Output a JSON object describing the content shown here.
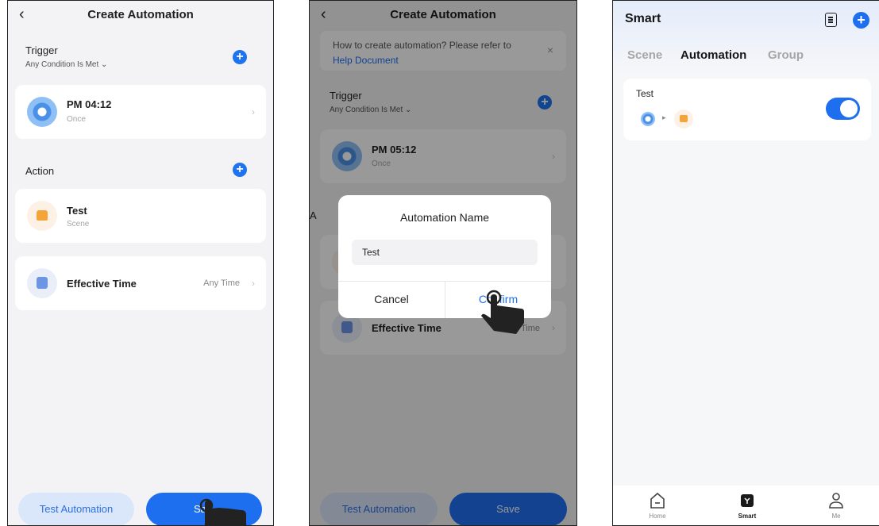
{
  "screen1": {
    "header_title": "Create Automation",
    "back_glyph": "‹",
    "trigger_title": "Trigger",
    "trigger_condition": "Any Condition Is Met",
    "trigger_card": {
      "title": "PM 04:12",
      "subtitle": "Once",
      "icon": "clock-icon"
    },
    "action_title": "Action",
    "action_card": {
      "title": "Test",
      "subtitle": "Scene",
      "icon": "scene-house-icon"
    },
    "effective_card": {
      "title": "Effective Time",
      "value": "Any Time",
      "icon": "calendar-icon"
    },
    "test_button": "Test Automation",
    "save_button": "Sa"
  },
  "screen2": {
    "header_title": "Create Automation",
    "tip_text": "How to create automation? Please refer to",
    "tip_link": "Help Document",
    "trigger_title": "Trigger",
    "trigger_condition": "Any Condition Is Met",
    "trigger_card": {
      "title": "PM 05:12",
      "subtitle": "Once"
    },
    "action_title_partial": "A",
    "effective_card": {
      "title": "Effective Time",
      "value_partial": "Time"
    },
    "dialog": {
      "title": "Automation Name",
      "input_value": "Test",
      "cancel": "Cancel",
      "confirm_prefix": "Co",
      "confirm_suffix": "firm"
    },
    "test_button": "Test Automation",
    "save_button": "Save"
  },
  "screen3": {
    "title": "Smart",
    "tabs": [
      {
        "label": "Scene",
        "active": false
      },
      {
        "label": "Automation",
        "active": true
      },
      {
        "label": "Group",
        "active": false
      }
    ],
    "automation_card": {
      "name": "Test",
      "enabled": true
    },
    "tabbar": [
      {
        "label": "Home",
        "icon": "home-icon"
      },
      {
        "label": "Smart",
        "icon": "smart-icon"
      },
      {
        "label": "Me",
        "icon": "user-icon"
      }
    ]
  },
  "colors": {
    "accent": "#1e6ff0",
    "background": "#f3f3f5",
    "scene_orange": "#f4a53a"
  }
}
